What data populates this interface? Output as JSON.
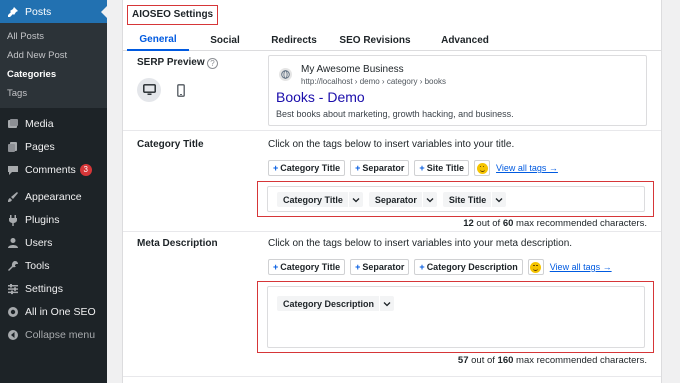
{
  "sidebar": {
    "posts": "Posts",
    "submenu": [
      "All Posts",
      "Add New Post",
      "Categories",
      "Tags"
    ],
    "items": [
      {
        "label": "Media"
      },
      {
        "label": "Pages"
      },
      {
        "label": "Comments",
        "badge": "3"
      },
      {
        "label": "Appearance"
      },
      {
        "label": "Plugins"
      },
      {
        "label": "Users"
      },
      {
        "label": "Tools"
      },
      {
        "label": "Settings"
      },
      {
        "label": "All in One SEO"
      },
      {
        "label": "Collapse menu"
      }
    ]
  },
  "panel": {
    "title": "AIOSEO Settings",
    "tabs": [
      "General",
      "Social",
      "Redirects",
      "SEO Revisions",
      "Advanced"
    ]
  },
  "serp": {
    "label": "SERP Preview",
    "help": "?",
    "site_name": "My Awesome Business",
    "url": "http://localhost › demo › category › books",
    "link_title": "Books - Demo",
    "description": "Best books about marketing, growth hacking, and business."
  },
  "category_title": {
    "label": "Category Title",
    "hint": "Click on the tags below to insert variables into your title.",
    "tag_buttons": [
      "Category Title",
      "Separator",
      "Site Title"
    ],
    "view_all": "View all tags →",
    "chips": [
      "Category Title",
      "Separator",
      "Site Title"
    ],
    "count": "12",
    "max": "60",
    "count_prefix": " out of ",
    "count_suffix": " max recommended characters."
  },
  "meta_description": {
    "label": "Meta Description",
    "hint": "Click on the tags below to insert variables into your meta description.",
    "tag_buttons": [
      "Category Title",
      "Separator",
      "Category Description"
    ],
    "view_all": "View all tags →",
    "chips": [
      "Category Description"
    ],
    "count": "57",
    "max": "160",
    "count_prefix": " out of ",
    "count_suffix": " max recommended characters."
  },
  "colors": {
    "sidebar_bg": "#1d2327",
    "active_menu": "#2271b1",
    "accent_blue": "#005ae0",
    "highlight_red": "#d63638",
    "serp_link": "#1a0dab"
  }
}
